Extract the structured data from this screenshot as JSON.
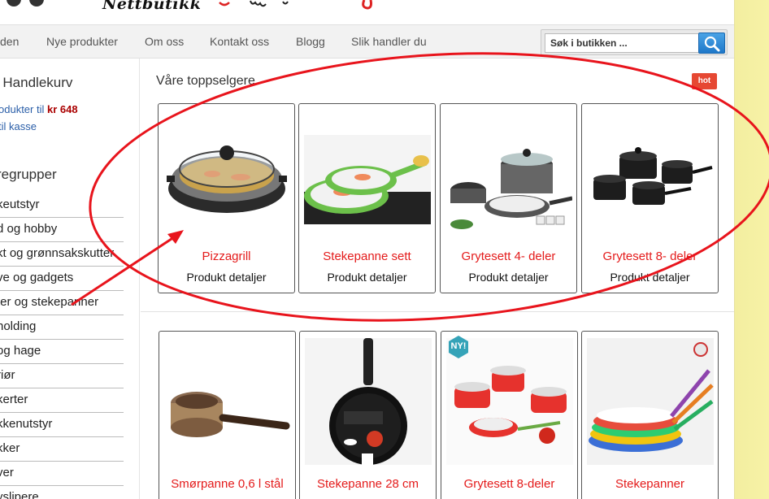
{
  "header": {
    "logo_text": "Nettbutikk"
  },
  "nav": {
    "items": [
      "den",
      "Nye produkter",
      "Om oss",
      "Kontakt oss",
      "Blogg",
      "Slik handler du"
    ],
    "search_placeholder": "Søk i butikken ..."
  },
  "sidebar": {
    "cart_title": "Handlekurv",
    "cart_line1_prefix": "odukter til ",
    "cart_total": "kr 648",
    "cart_line2": "til kasse",
    "groups_title": "regrupper",
    "categories": [
      "keutstyr",
      "d og hobby",
      "kt og grønnsakskutter",
      "ve og gadgets",
      "ter og stekepanner",
      "holding",
      " og hage",
      "riør",
      "kerter",
      "kkenutstyr",
      "kker",
      "ver",
      "yslipere"
    ]
  },
  "main": {
    "section_title": "Våre toppselgere",
    "hot_badge": "hot",
    "top_products": [
      {
        "title": "Pizzagrill",
        "detail": "Produkt detaljer"
      },
      {
        "title": "Stekepanne sett",
        "detail": "Produkt detaljer"
      },
      {
        "title": "Grytesett 4- deler",
        "detail": "Produkt detaljer"
      },
      {
        "title": "Grytesett 8- deler",
        "detail": "Produkt detaljer"
      }
    ],
    "more_products": [
      {
        "title": "Smørpanne 0,6 l stål"
      },
      {
        "title": "Stekepanne 28 cm"
      },
      {
        "title": "Grytesett 8-deler",
        "badge": "NY!"
      },
      {
        "title": "Stekepanner"
      }
    ]
  },
  "colors": {
    "accent_red": "#e41b1b",
    "annotation_red": "#e8141c",
    "link_blue": "#2a5ea8",
    "search_blue": "#1f78c9"
  }
}
